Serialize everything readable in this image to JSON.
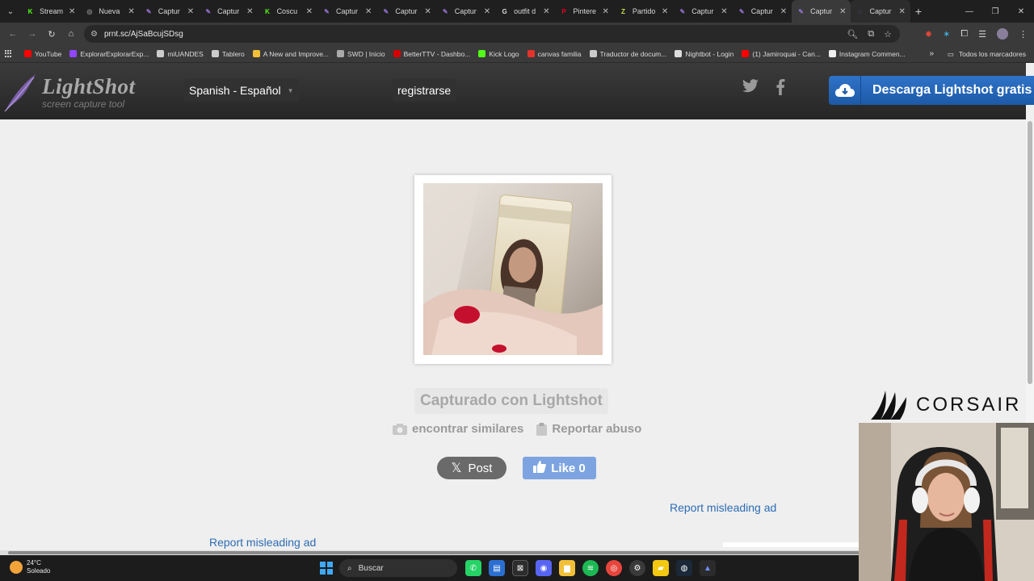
{
  "browser": {
    "tabs": [
      {
        "label": "Stream",
        "color": "#53fc18",
        "glyph": "K"
      },
      {
        "label": "Nueva",
        "color": "#888888",
        "glyph": "◎"
      },
      {
        "label": "Captur",
        "color": "#8e6fc9",
        "glyph": "✎"
      },
      {
        "label": "Captur",
        "color": "#8e6fc9",
        "glyph": "✎"
      },
      {
        "label": "Coscu",
        "color": "#53fc18",
        "glyph": "K"
      },
      {
        "label": "Captur",
        "color": "#8e6fc9",
        "glyph": "✎"
      },
      {
        "label": "Captur",
        "color": "#8e6fc9",
        "glyph": "✎"
      },
      {
        "label": "Captur",
        "color": "#8e6fc9",
        "glyph": "✎"
      },
      {
        "label": "outfit d",
        "color": "#dddddd",
        "glyph": "G"
      },
      {
        "label": "Pinterе",
        "color": "#e60023",
        "glyph": "P"
      },
      {
        "label": "Partido",
        "color": "#c8e04a",
        "glyph": "Z"
      },
      {
        "label": "Captur",
        "color": "#8e6fc9",
        "glyph": "✎"
      },
      {
        "label": "Captur",
        "color": "#8e6fc9",
        "glyph": "✎"
      },
      {
        "label": "Captur",
        "color": "#8e6fc9",
        "glyph": "✎",
        "active": true
      },
      {
        "label": "Captur",
        "color": "#8e6fc9",
        "glyph": "◌",
        "hover": true
      }
    ],
    "url": "prnt.sc/AjSaBcujSDsg",
    "bookmarks": [
      {
        "label": "YouTube",
        "color": "#ff0000"
      },
      {
        "label": "ExplorarExplorarExp...",
        "color": "#9146ff"
      },
      {
        "label": "miUANDES",
        "color": "#cccccc"
      },
      {
        "label": "Tablero",
        "color": "#cccccc"
      },
      {
        "label": "A New and Improve...",
        "color": "#f2c037"
      },
      {
        "label": "SWD | Inicio",
        "color": "#aaaaaa"
      },
      {
        "label": "BetterTTV - Dashbo...",
        "color": "#d50000"
      },
      {
        "label": "Kick Logo",
        "color": "#53fc18"
      },
      {
        "label": "canvas familia",
        "color": "#e4332b"
      },
      {
        "label": "Traductor de docum...",
        "color": "#cccccc"
      },
      {
        "label": "Nightbot - Login",
        "color": "#dddddd"
      },
      {
        "label": "(1) Jamiroquai - Can...",
        "color": "#ff0000"
      },
      {
        "label": "Instagram Commen...",
        "color": "#eeeeee"
      }
    ],
    "all_bookmarks": "Todos los marcadores",
    "more": "»"
  },
  "site": {
    "logo_name": "LightShot",
    "logo_tagline": "screen capture tool",
    "language": "Spanish - Español",
    "register": "registrarse",
    "download": "Descarga Lightshot gratis",
    "captured": "Capturado con Lightshot",
    "find_similar": "encontrar similares",
    "report_abuse": "Reportar abuso",
    "post": "Post",
    "like": "Like 0",
    "report_ad_1": "Report misleading ad",
    "report_ad_2": "Report misleading ad"
  },
  "overlay": {
    "sponsor": "CORSAIR"
  },
  "taskbar": {
    "temperature": "24°C",
    "condition": "Soleado",
    "search_placeholder": "Buscar"
  }
}
